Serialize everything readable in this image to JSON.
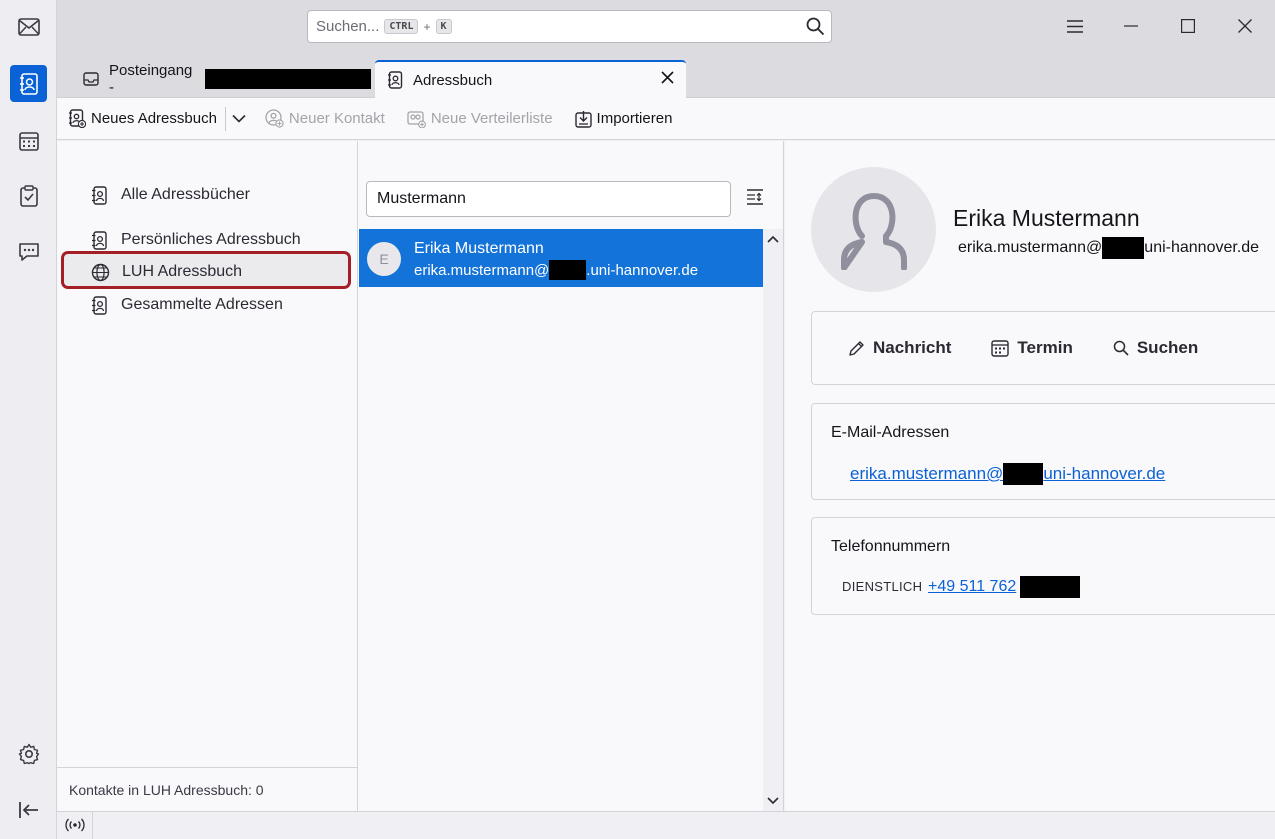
{
  "spaces": {
    "items": [
      {
        "name": "mail",
        "icon": "mail-icon",
        "active": false
      },
      {
        "name": "address-book",
        "icon": "address-book-icon",
        "active": true
      },
      {
        "name": "calendar",
        "icon": "calendar-icon",
        "active": false
      },
      {
        "name": "tasks",
        "icon": "tasks-icon",
        "active": false
      },
      {
        "name": "chat",
        "icon": "chat-icon",
        "active": false
      }
    ],
    "bottom": [
      "settings-icon",
      "collapse-icon"
    ]
  },
  "search": {
    "placeholder": "Suchen...",
    "shortcut_mod": "CTRL",
    "shortcut_plus": "+",
    "shortcut_key": "K"
  },
  "tabs": [
    {
      "label": "Posteingang -",
      "icon": "inbox-icon",
      "active": false
    },
    {
      "label": "Adressbuch",
      "icon": "address-book-icon",
      "active": true
    }
  ],
  "toolbar": {
    "new_book": "Neues Adressbuch",
    "new_contact": "Neuer Kontakt",
    "new_list": "Neue Verteilerliste",
    "import": "Importieren"
  },
  "books": {
    "items": [
      {
        "label": "Alle Adressbücher",
        "icon": "address-book-icon"
      },
      {
        "label": "Persönliches Adressbuch",
        "icon": "address-book-icon"
      },
      {
        "label": "LUH Adressbuch",
        "icon": "globe-icon",
        "selected": true
      },
      {
        "label": "Gesammelte Adressen",
        "icon": "address-book-icon"
      }
    ],
    "footer": "Kontakte in LUH Adressbuch: 0"
  },
  "cards": {
    "search_value": "Mustermann",
    "rows": [
      {
        "initial": "E",
        "name": "Erika Mustermann",
        "email_prefix": "erika.mustermann@",
        "email_suffix": ".uni-hannover.de"
      }
    ]
  },
  "details": {
    "name": "Erika Mustermann",
    "email_prefix": "erika.mustermann@",
    "email_suffix": "uni-hannover.de",
    "actions": {
      "message": "Nachricht",
      "event": "Termin",
      "search": "Suchen"
    },
    "emails_title": "E-Mail-Adressen",
    "email_link_prefix": "erika.mustermann@",
    "email_link_suffix": "uni-hannover.de",
    "phones_title": "Telefonnummern",
    "phone_type": "DIENSTLICH",
    "phone_value": "+49 511 762"
  },
  "colors": {
    "accent": "#0b61d6",
    "selection": "#1373d9",
    "highlight_border": "#a41f25"
  }
}
